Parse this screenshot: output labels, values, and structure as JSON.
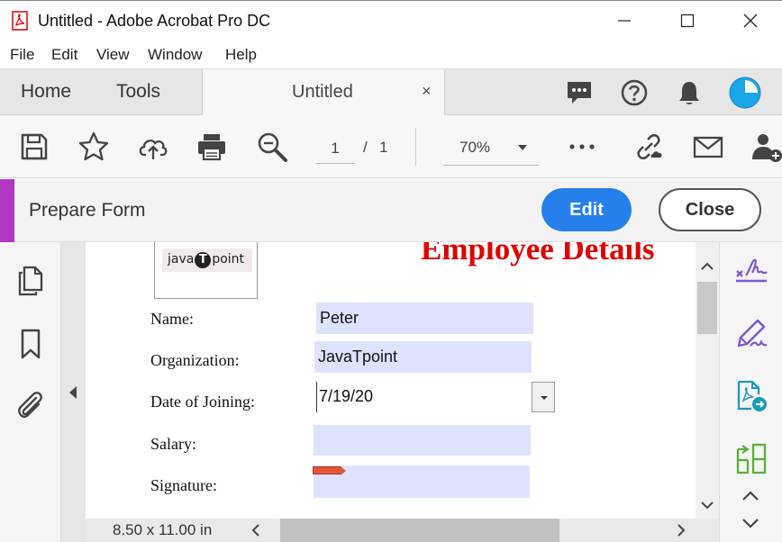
{
  "window": {
    "title": "Untitled - Adobe Acrobat Pro DC",
    "icons": {
      "app": "pdf-icon",
      "minimize": "minimize-icon",
      "maximize": "maximize-icon",
      "close": "close-icon"
    }
  },
  "menubar": {
    "items": [
      "File",
      "Edit",
      "View",
      "Window",
      "Help"
    ]
  },
  "tabbar": {
    "home_label": "Home",
    "tools_label": "Tools",
    "doc_tab_label": "Untitled",
    "doc_tab_close": "×",
    "icons": [
      "comment-icon",
      "help-icon",
      "bell-icon",
      "account-avatar-icon"
    ]
  },
  "toolbar": {
    "icons": [
      "save-icon",
      "bookmark-star-icon",
      "upload-cloud-icon",
      "print-icon",
      "zoom-search-icon",
      "more-icon",
      "share-link-icon",
      "email-icon",
      "add-user-icon"
    ],
    "page_current": "1",
    "page_separator": "/",
    "page_total": "1",
    "zoom_value": "70%"
  },
  "prepare_form": {
    "title": "Prepare Form",
    "edit_label": "Edit",
    "close_label": "Close",
    "accent_color": "#b436c5",
    "edit_color": "#2680eb"
  },
  "left_pane": {
    "icons": [
      "pages-icon",
      "bookmark-icon",
      "attachment-icon"
    ]
  },
  "document": {
    "logo_text_left": "java",
    "logo_text_mid": "T",
    "logo_text_right": "point",
    "heading": "Employee Details",
    "heading_color": "#e00000",
    "field_color": "#dde3ff",
    "fields": [
      {
        "label": "Name:",
        "value": "Peter"
      },
      {
        "label": "Organization:",
        "value": "JavaTpoint"
      },
      {
        "label": "Date of Joining:",
        "value": "7/19/20"
      },
      {
        "label": "Salary:",
        "value": ""
      },
      {
        "label": "Signature:",
        "value": ""
      }
    ]
  },
  "statusbar": {
    "page_size": "8.50 x 11.00 in"
  },
  "right_pane": {
    "icons": [
      "fill-sign-icon",
      "request-signature-icon",
      "export-pdf-icon",
      "organize-pages-icon",
      "chevron-up-icon",
      "chevron-down-icon"
    ]
  }
}
